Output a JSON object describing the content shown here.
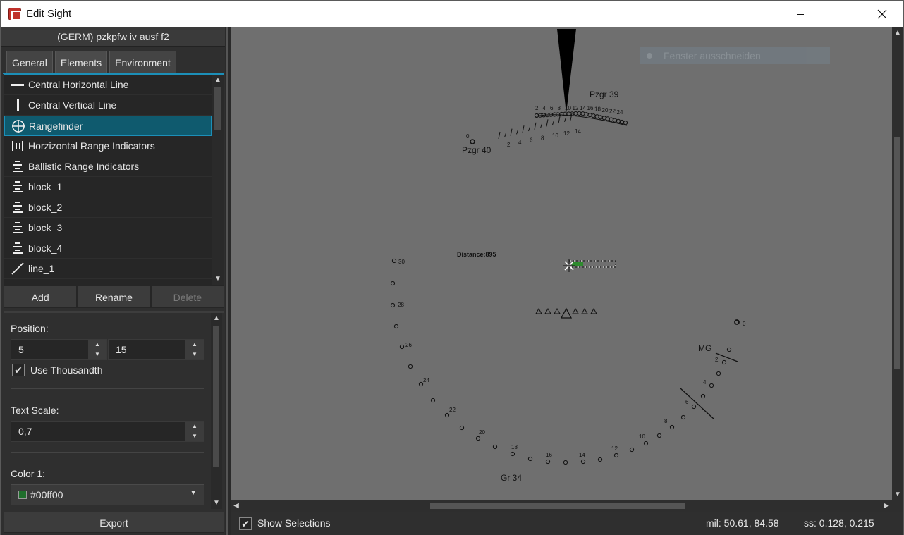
{
  "window": {
    "title": "Edit Sight"
  },
  "left": {
    "tank": "(GERM) pzkpfw iv ausf f2",
    "tabs": [
      "General",
      "Elements",
      "Environment"
    ],
    "list": [
      {
        "label": "Central Horizontal Line",
        "icon": "horizontal-line-icon"
      },
      {
        "label": "Central Vertical Line",
        "icon": "vertical-line-icon"
      },
      {
        "label": "Rangefinder",
        "icon": "crosshair-circle-icon",
        "selected": true
      },
      {
        "label": "Horzizontal Range Indicators",
        "icon": "range-bars-icon"
      },
      {
        "label": "Ballistic Range Indicators",
        "icon": "stacked-lines-icon"
      },
      {
        "label": "block_1",
        "icon": "stacked-lines-icon"
      },
      {
        "label": "block_2",
        "icon": "stacked-lines-icon"
      },
      {
        "label": "block_3",
        "icon": "stacked-lines-icon"
      },
      {
        "label": "block_4",
        "icon": "stacked-lines-icon"
      },
      {
        "label": "line_1",
        "icon": "diagonal-line-icon"
      }
    ],
    "buttons": {
      "add": "Add",
      "rename": "Rename",
      "delete": "Delete"
    },
    "props": {
      "position_label": "Position:",
      "pos_x": "5",
      "pos_y": "15",
      "use_thousandth": "Use Thousandth",
      "text_scale_label": "Text Scale:",
      "text_scale": "0,7",
      "color1_label": "Color 1:",
      "color1": "#00ff00"
    },
    "export": "Export"
  },
  "canvas": {
    "ghost_text": "Fenster ausschneiden",
    "labels": {
      "pzgr39": "Pzgr 39",
      "pzgr40": "Pzgr 40",
      "distance": "Distance:895",
      "mg": "MG",
      "gr34": "Gr 34"
    },
    "pzgr39_ticks": [
      "2",
      "4",
      "6",
      "8",
      "10",
      "12",
      "14",
      "16",
      "18",
      "20",
      "22",
      "24"
    ],
    "pzgr40_ticks": [
      "2",
      "4",
      "6",
      "8",
      "10",
      "12",
      "14"
    ],
    "pzgr40_zero": "0",
    "gr34_ticks": [
      "30",
      "28",
      "26",
      "24",
      "22",
      "20",
      "18",
      "16",
      "14",
      "12",
      "10",
      "8",
      "6",
      "4",
      "2",
      "0"
    ]
  },
  "status": {
    "show_selections": "Show Selections",
    "mil": "mil: 50.61, 84.58",
    "ss": "ss: 0.128, 0.215"
  },
  "colors": {
    "accent": "#1c8fb8",
    "selected_bg": "#0f5a6e",
    "canvas_bg": "#6f6f6f"
  }
}
